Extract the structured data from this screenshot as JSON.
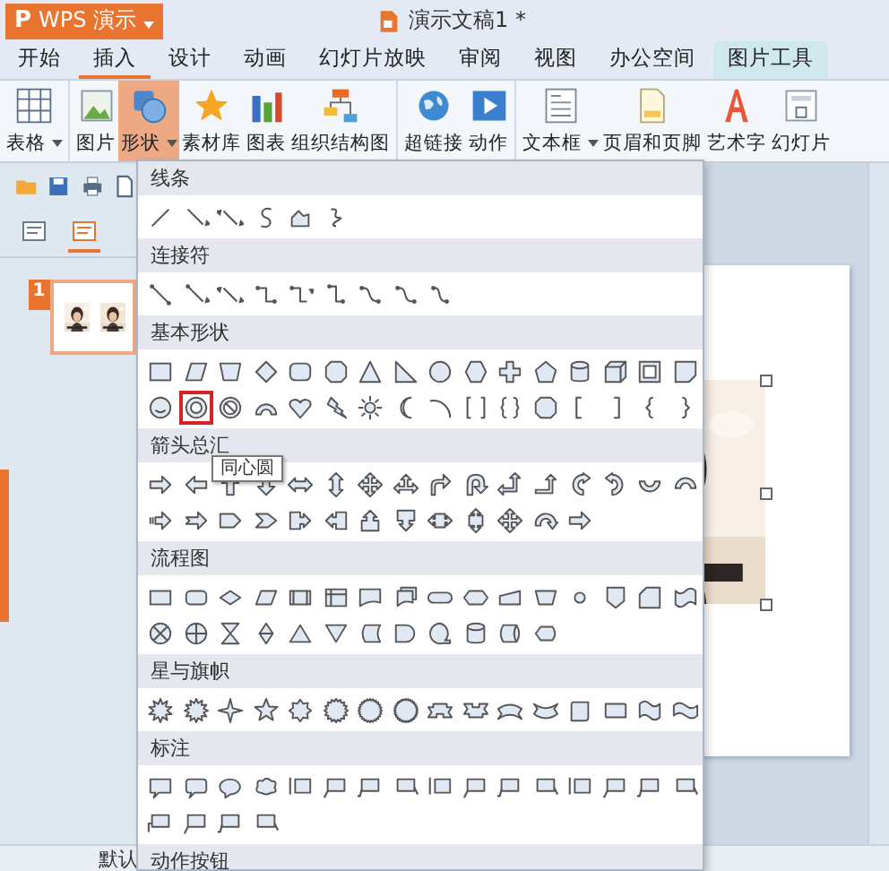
{
  "app_menu": {
    "logo": "P",
    "label": "WPS 演示"
  },
  "window": {
    "title": "演示文稿1 *"
  },
  "tabs": [
    {
      "label": "开始",
      "selected": false,
      "kind": "normal"
    },
    {
      "label": "插入",
      "selected": true,
      "kind": "normal"
    },
    {
      "label": "设计",
      "selected": false,
      "kind": "normal"
    },
    {
      "label": "动画",
      "selected": false,
      "kind": "normal"
    },
    {
      "label": "幻灯片放映",
      "selected": false,
      "kind": "normal"
    },
    {
      "label": "审阅",
      "selected": false,
      "kind": "normal"
    },
    {
      "label": "视图",
      "selected": false,
      "kind": "normal"
    },
    {
      "label": "办公空间",
      "selected": false,
      "kind": "normal"
    },
    {
      "label": "图片工具",
      "selected": false,
      "kind": "context"
    }
  ],
  "toolbar": {
    "groups": [
      [
        {
          "label": "表格",
          "has_menu": true,
          "active": false
        }
      ],
      [
        {
          "label": "图片",
          "has_menu": false,
          "active": false
        },
        {
          "label": "形状",
          "has_menu": true,
          "active": true
        },
        {
          "label": "素材库",
          "has_menu": false,
          "active": false
        },
        {
          "label": "图表",
          "has_menu": false,
          "active": false
        },
        {
          "label": "组织结构图",
          "has_menu": false,
          "active": false
        }
      ],
      [
        {
          "label": "超链接",
          "has_menu": false,
          "active": false
        },
        {
          "label": "动作",
          "has_menu": false,
          "active": false
        }
      ],
      [
        {
          "label": "文本框",
          "has_menu": true,
          "active": false
        },
        {
          "label": "页眉和页脚",
          "has_menu": false,
          "active": false
        },
        {
          "label": "艺术字",
          "has_menu": false,
          "active": false
        },
        {
          "label": "幻灯片",
          "has_menu": false,
          "active": false
        }
      ]
    ]
  },
  "slides_pane": {
    "tabs": [
      {
        "selected": false
      },
      {
        "selected": true
      }
    ],
    "slides": [
      {
        "number": "1",
        "selected": true
      }
    ]
  },
  "status_bar": {
    "text": "默认"
  },
  "shapes_menu": {
    "tooltip": "同心圆",
    "sections": [
      {
        "title": "线条",
        "rows": [
          {
            "shapes": [
              {
                "selected": false
              },
              {
                "selected": false
              },
              {
                "selected": false
              },
              {
                "selected": false
              },
              {
                "selected": false
              },
              {
                "selected": false
              }
            ]
          }
        ]
      },
      {
        "title": "连接符",
        "rows": [
          {
            "shapes": [
              {
                "selected": false
              },
              {
                "selected": false
              },
              {
                "selected": false
              },
              {
                "selected": false
              },
              {
                "selected": false
              },
              {
                "selected": false
              },
              {
                "selected": false
              },
              {
                "selected": false
              },
              {
                "selected": false
              }
            ]
          }
        ]
      },
      {
        "title": "基本形状",
        "rows": [
          {
            "shapes": [
              {
                "selected": false
              },
              {
                "selected": false
              },
              {
                "selected": false
              },
              {
                "selected": false
              },
              {
                "selected": false
              },
              {
                "selected": false
              },
              {
                "selected": false
              },
              {
                "selected": false
              },
              {
                "selected": false
              },
              {
                "selected": false
              },
              {
                "selected": false
              },
              {
                "selected": false
              },
              {
                "selected": false
              },
              {
                "selected": false
              },
              {
                "selected": false
              },
              {
                "selected": false
              }
            ]
          },
          {
            "shapes": [
              {
                "selected": false
              },
              {
                "selected": true
              },
              {
                "selected": false
              },
              {
                "selected": false
              },
              {
                "selected": false
              },
              {
                "selected": false
              },
              {
                "selected": false
              },
              {
                "selected": false
              },
              {
                "selected": false
              },
              {
                "selected": false
              },
              {
                "selected": false
              },
              {
                "selected": false
              },
              {
                "selected": false
              },
              {
                "selected": false
              },
              {
                "selected": false
              },
              {
                "selected": false
              }
            ]
          }
        ]
      },
      {
        "title": "箭头总汇",
        "rows": [
          {
            "shapes": [
              {
                "selected": false
              },
              {
                "selected": false
              },
              {
                "selected": false
              },
              {
                "selected": false
              },
              {
                "selected": false
              },
              {
                "selected": false
              },
              {
                "selected": false
              },
              {
                "selected": false
              },
              {
                "selected": false
              },
              {
                "selected": false
              },
              {
                "selected": false
              },
              {
                "selected": false
              },
              {
                "selected": false
              },
              {
                "selected": false
              },
              {
                "selected": false
              },
              {
                "selected": false
              }
            ]
          },
          {
            "shapes": [
              {
                "selected": false
              },
              {
                "selected": false
              },
              {
                "selected": false
              },
              {
                "selected": false
              },
              {
                "selected": false
              },
              {
                "selected": false
              },
              {
                "selected": false
              },
              {
                "selected": false
              },
              {
                "selected": false
              },
              {
                "selected": false
              },
              {
                "selected": false
              },
              {
                "selected": false
              },
              {
                "selected": false
              }
            ]
          }
        ]
      },
      {
        "title": "流程图",
        "rows": [
          {
            "shapes": [
              {
                "selected": false
              },
              {
                "selected": false
              },
              {
                "selected": false
              },
              {
                "selected": false
              },
              {
                "selected": false
              },
              {
                "selected": false
              },
              {
                "selected": false
              },
              {
                "selected": false
              },
              {
                "selected": false
              },
              {
                "selected": false
              },
              {
                "selected": false
              },
              {
                "selected": false
              },
              {
                "selected": false
              },
              {
                "selected": false
              },
              {
                "selected": false
              },
              {
                "selected": false
              }
            ]
          },
          {
            "shapes": [
              {
                "selected": false
              },
              {
                "selected": false
              },
              {
                "selected": false
              },
              {
                "selected": false
              },
              {
                "selected": false
              },
              {
                "selected": false
              },
              {
                "selected": false
              },
              {
                "selected": false
              },
              {
                "selected": false
              },
              {
                "selected": false
              },
              {
                "selected": false
              },
              {
                "selected": false
              }
            ]
          }
        ]
      },
      {
        "title": "星与旗帜",
        "rows": [
          {
            "shapes": [
              {
                "selected": false
              },
              {
                "selected": false
              },
              {
                "selected": false
              },
              {
                "selected": false
              },
              {
                "selected": false
              },
              {
                "selected": false
              },
              {
                "selected": false
              },
              {
                "selected": false
              },
              {
                "selected": false
              },
              {
                "selected": false
              },
              {
                "selected": false
              },
              {
                "selected": false
              },
              {
                "selected": false
              },
              {
                "selected": false
              },
              {
                "selected": false
              },
              {
                "selected": false
              }
            ]
          }
        ]
      },
      {
        "title": "标注",
        "rows": [
          {
            "shapes": [
              {
                "selected": false
              },
              {
                "selected": false
              },
              {
                "selected": false
              },
              {
                "selected": false
              },
              {
                "selected": false
              },
              {
                "selected": false
              },
              {
                "selected": false
              },
              {
                "selected": false
              },
              {
                "selected": false
              },
              {
                "selected": false
              },
              {
                "selected": false
              },
              {
                "selected": false
              },
              {
                "selected": false
              },
              {
                "selected": false
              },
              {
                "selected": false
              },
              {
                "selected": false
              }
            ]
          },
          {
            "shapes": [
              {
                "selected": false
              },
              {
                "selected": false
              },
              {
                "selected": false
              },
              {
                "selected": false
              }
            ]
          }
        ]
      },
      {
        "title": "动作按钮"
      }
    ]
  }
}
